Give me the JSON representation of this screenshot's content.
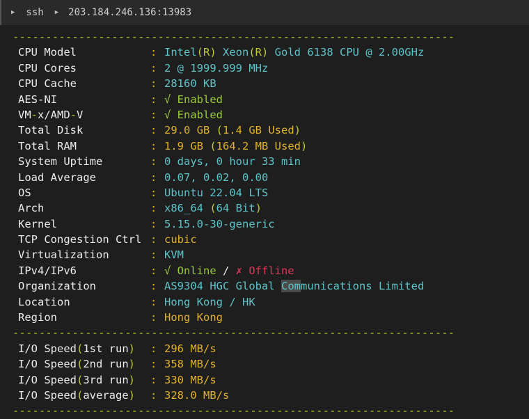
{
  "tab": {
    "app": "ssh",
    "host": "203.184.246.136:13983"
  },
  "divider": "-------------------------------------------------------------------",
  "sysinfo": {
    "cpu_model": {
      "label": "CPU Model",
      "v1": "Intel",
      "v2": "(R)",
      "v3": " Xeon",
      "v4": "(R)",
      "v5": " Gold 6138 CPU @ 2.00GHz"
    },
    "cpu_cores": {
      "label": "CPU Cores",
      "value": "2 @ 1999.999 MHz"
    },
    "cpu_cache": {
      "label": "CPU Cache",
      "value": "28160 KB"
    },
    "aes_ni": {
      "label": "AES-NI",
      "value": "√ Enabled"
    },
    "vmx": {
      "label_a": "VM",
      "label_b": "-",
      "label_c": "x/AMD",
      "label_d": "-",
      "label_e": "V",
      "value": "√ Enabled"
    },
    "total_disk": {
      "label": "Total Disk",
      "v1": "29.0 GB ",
      "v2": "(",
      "v3": "1.4 GB Used",
      "v4": ")"
    },
    "total_ram": {
      "label": "Total RAM",
      "v1": "1.9 GB ",
      "v2": "(",
      "v3": "164.2 MB Used",
      "v4": ")"
    },
    "uptime": {
      "label": "System Uptime",
      "value": "0 days, 0 hour 33 min"
    },
    "load": {
      "label": "Load Average",
      "value": "0.07, 0.02, 0.00"
    },
    "os": {
      "label": "OS",
      "value": "Ubuntu 22.04 LTS"
    },
    "arch": {
      "label": "Arch",
      "v1": "x86_64 ",
      "v2": "(",
      "v3": "64 Bit",
      "v4": ")"
    },
    "kernel": {
      "label": "Kernel",
      "value": "5.15.0-30-generic"
    },
    "tcp": {
      "label": "TCP Congestion Ctrl",
      "value": "cubic"
    },
    "virt": {
      "label": "Virtualization",
      "value": "KVM"
    },
    "ipv": {
      "label": "IPv4/IPv6",
      "online": "√ Online",
      "slash": " / ",
      "offline": "✗ Offline"
    },
    "org": {
      "label": "Organization",
      "v1": "AS9304 HGC Global ",
      "v2": "Com",
      "v3": "munications Limited"
    },
    "location": {
      "label": "Location",
      "value": "Hong Kong / HK"
    },
    "region": {
      "label": "Region",
      "value": "Hong Kong"
    }
  },
  "io": [
    {
      "a": "I/O Speed",
      "b": "(",
      "c": "1st run",
      "d": ")",
      "value": "296 MB/s"
    },
    {
      "a": "I/O Speed",
      "b": "(",
      "c": "2nd run",
      "d": ")",
      "value": "358 MB/s"
    },
    {
      "a": "I/O Speed",
      "b": "(",
      "c": "3rd run",
      "d": ")",
      "value": "330 MB/s"
    },
    {
      "a": "I/O Speed",
      "b": "(",
      "c": "average",
      "d": ")",
      "value": "328.0 MB/s"
    }
  ],
  "colon": ": ",
  "colon_io": " : "
}
